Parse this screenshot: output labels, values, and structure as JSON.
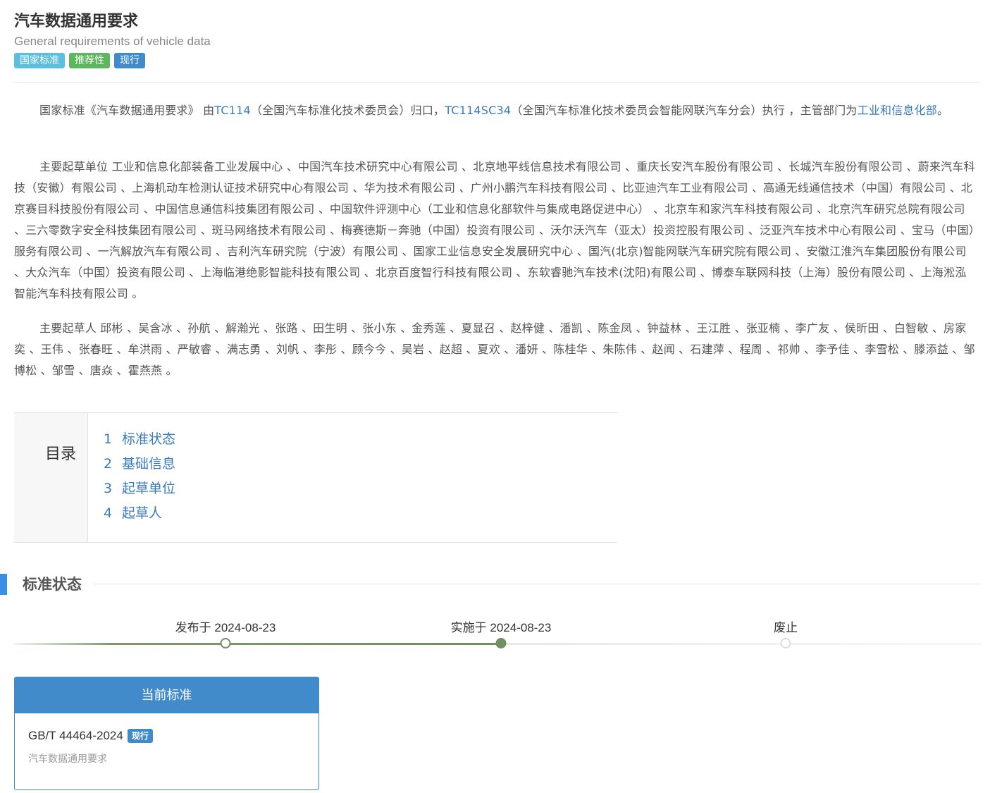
{
  "header": {
    "title": "汽车数据通用要求",
    "subtitle": "General requirements of vehicle data",
    "badges": [
      "国家标准",
      "推荐性",
      "现行"
    ]
  },
  "intro": {
    "t1": "国家标准《汽车数据通用要求》 由",
    "tc": "TC114",
    "t2": "（全国汽车标准化技术委员会）归口，",
    "sc": "TC114SC34",
    "t3": "（全国汽车标准化技术委员会智能网联汽车分会）执行 ，主管部门为",
    "dept": "工业和信息化部",
    "t4": "。"
  },
  "drafting_units": "主要起草单位 工业和信息化部装备工业发展中心 、中国汽车技术研究中心有限公司 、北京地平线信息技术有限公司 、重庆长安汽车股份有限公司 、长城汽车股份有限公司 、蔚来汽车科技（安徽）有限公司 、上海机动车检测认证技术研究中心有限公司 、华为技术有限公司 、广州小鹏汽车科技有限公司 、比亚迪汽车工业有限公司 、高通无线通信技术（中国）有限公司 、北京赛目科技股份有限公司 、中国信息通信科技集团有限公司 、中国软件评测中心（工业和信息化部软件与集成电路促进中心） 、北京车和家汽车科技有限公司 、北京汽车研究总院有限公司 、三六零数字安全科技集团有限公司 、斑马网络技术有限公司 、梅赛德斯－奔驰（中国）投资有限公司 、沃尔沃汽车（亚太）投资控股有限公司 、泛亚汽车技术中心有限公司 、宝马（中国）服务有限公司 、一汽解放汽车有限公司 、吉利汽车研究院（宁波）有限公司 、国家工业信息安全发展研究中心 、国汽(北京)智能网联汽车研究院有限公司 、安徽江淮汽车集团股份有限公司 、大众汽车（中国）投资有限公司 、上海临港绝影智能科技有限公司 、北京百度智行科技有限公司 、东软睿驰汽车技术(沈阳)有限公司 、博泰车联网科技（上海）股份有限公司 、上海淞泓智能汽车科技有限公司 。",
  "drafters": "主要起草人 邱彬 、吴含冰 、孙航 、解瀚光 、张路 、田生明 、张小东 、金秀莲 、夏显召 、赵梓健 、潘凯 、陈金凤 、钟益林 、王江胜 、张亚楠 、李广友 、侯昕田 、白智敏 、房家奕 、王伟 、张春旺 、牟洪雨 、严敏睿 、满志勇 、刘帆 、李彤 、顾今今 、吴岩 、赵超 、夏欢 、潘妍 、陈桂华 、朱陈伟 、赵闻 、石建萍 、程周 、祁帅 、李予佳 、李雪松 、滕添益 、邹博松 、邹雪 、唐焱 、霍燕燕 。",
  "toc": {
    "label": "目录",
    "items": [
      {
        "num": "1",
        "label": "标准状态"
      },
      {
        "num": "2",
        "label": "基础信息"
      },
      {
        "num": "3",
        "label": "起草单位"
      },
      {
        "num": "4",
        "label": "起草人"
      }
    ]
  },
  "status_section": {
    "title": "标准状态",
    "timeline": [
      {
        "label": "发布于 2024-08-23",
        "state": "done"
      },
      {
        "label": "实施于 2024-08-23",
        "state": "current"
      },
      {
        "label": "废止",
        "state": "pending"
      }
    ]
  },
  "current_card": {
    "header": "当前标准",
    "code": "GB/T 44464-2024",
    "badge": "现行",
    "name": "汽车数据通用要求"
  },
  "colors": {
    "link": "#3a7bbf",
    "badge_teal": "#5bc0de",
    "badge_green": "#5cb85c",
    "badge_blue": "#428bca",
    "timeline_green": "#6e9162",
    "section_accent": "#3a8ee6"
  }
}
